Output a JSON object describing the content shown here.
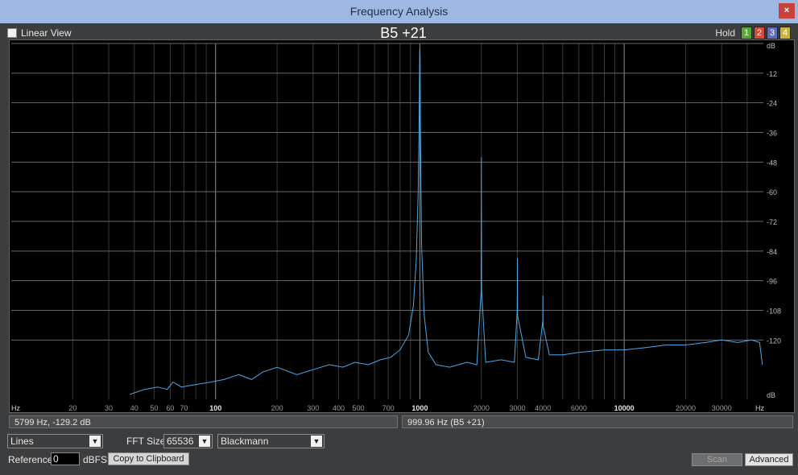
{
  "window": {
    "title": "Frequency Analysis",
    "close_glyph": "×"
  },
  "top": {
    "linear_view_label": "Linear View",
    "note": "B5 +21",
    "hold_label": "Hold",
    "hold_buttons": [
      {
        "label": "1",
        "color": "#5aa63c"
      },
      {
        "label": "2",
        "color": "#d54a3c"
      },
      {
        "label": "3",
        "color": "#5f6fb7"
      },
      {
        "label": "4",
        "color": "#c9b33d"
      }
    ]
  },
  "status": {
    "cursor": "5799 Hz, -129.2 dB",
    "peak": "999.96 Hz (B5 +21)"
  },
  "controls": {
    "display_mode": "Lines",
    "fft_size_label": "FFT Size",
    "fft_size": "65536",
    "window_function": "Blackmann",
    "reference_label": "Reference",
    "reference_value": "0",
    "reference_unit": "dBFS",
    "copy_label": "Copy to Clipboard",
    "scan_label": "Scan",
    "advanced_label": "Advanced"
  },
  "chart_data": {
    "type": "line",
    "scale": "log-frequency",
    "xlim": [
      10,
      48000
    ],
    "ylim": [
      -144,
      0
    ],
    "x_unit_label": "Hz",
    "y_unit_label": "dB",
    "x_ticks": [
      {
        "value": 20,
        "label": "20",
        "major": false
      },
      {
        "value": 30,
        "label": "30",
        "major": false
      },
      {
        "value": 40,
        "label": "40",
        "major": false
      },
      {
        "value": 50,
        "label": "50",
        "major": false
      },
      {
        "value": 60,
        "label": "60",
        "major": false
      },
      {
        "value": 70,
        "label": "70",
        "major": false
      },
      {
        "value": 100,
        "label": "100",
        "major": true
      },
      {
        "value": 200,
        "label": "200",
        "major": false
      },
      {
        "value": 300,
        "label": "300",
        "major": false
      },
      {
        "value": 400,
        "label": "400",
        "major": false
      },
      {
        "value": 500,
        "label": "500",
        "major": false
      },
      {
        "value": 700,
        "label": "700",
        "major": false
      },
      {
        "value": 1000,
        "label": "1000",
        "major": true
      },
      {
        "value": 2000,
        "label": "2000",
        "major": false
      },
      {
        "value": 3000,
        "label": "3000",
        "major": false
      },
      {
        "value": 4000,
        "label": "4000",
        "major": false
      },
      {
        "value": 6000,
        "label": "6000",
        "major": false
      },
      {
        "value": 10000,
        "label": "10000",
        "major": true
      },
      {
        "value": 20000,
        "label": "20000",
        "major": false
      },
      {
        "value": 30000,
        "label": "30000",
        "major": false
      }
    ],
    "y_ticks": [
      -12,
      -24,
      -36,
      -48,
      -60,
      -72,
      -84,
      -96,
      -108,
      -120
    ],
    "series": [
      {
        "color": "#4aa8e8",
        "points": [
          [
            38,
            -142
          ],
          [
            45,
            -140
          ],
          [
            52,
            -139
          ],
          [
            58,
            -140
          ],
          [
            62,
            -137
          ],
          [
            68,
            -139
          ],
          [
            80,
            -138
          ],
          [
            95,
            -137
          ],
          [
            110,
            -136
          ],
          [
            130,
            -134
          ],
          [
            150,
            -136
          ],
          [
            170,
            -133
          ],
          [
            200,
            -131
          ],
          [
            250,
            -134
          ],
          [
            300,
            -132
          ],
          [
            360,
            -130
          ],
          [
            420,
            -131
          ],
          [
            480,
            -129
          ],
          [
            560,
            -130
          ],
          [
            640,
            -128
          ],
          [
            720,
            -127
          ],
          [
            800,
            -124
          ],
          [
            880,
            -118
          ],
          [
            930,
            -106
          ],
          [
            960,
            -88
          ],
          [
            980,
            -62
          ],
          [
            990,
            -38
          ],
          [
            996,
            -12
          ],
          [
            998,
            -3
          ],
          [
            1000,
            -2
          ],
          [
            1002,
            -6
          ],
          [
            1006,
            -35
          ],
          [
            1020,
            -82
          ],
          [
            1050,
            -110
          ],
          [
            1100,
            -125
          ],
          [
            1200,
            -130
          ],
          [
            1400,
            -131
          ],
          [
            1700,
            -129
          ],
          [
            1900,
            -130
          ],
          [
            1995,
            -100
          ],
          [
            2000,
            -46
          ],
          [
            2005,
            -100
          ],
          [
            2100,
            -129
          ],
          [
            2500,
            -128
          ],
          [
            2900,
            -129
          ],
          [
            2995,
            -108
          ],
          [
            3000,
            -87
          ],
          [
            3005,
            -110
          ],
          [
            3300,
            -127
          ],
          [
            3800,
            -128
          ],
          [
            3995,
            -112
          ],
          [
            4000,
            -102
          ],
          [
            4005,
            -114
          ],
          [
            4300,
            -126
          ],
          [
            5000,
            -126
          ],
          [
            6000,
            -125
          ],
          [
            8000,
            -124
          ],
          [
            10000,
            -124
          ],
          [
            13000,
            -123
          ],
          [
            16000,
            -122
          ],
          [
            20000,
            -122
          ],
          [
            25000,
            -121
          ],
          [
            30000,
            -120
          ],
          [
            36000,
            -121
          ],
          [
            42000,
            -120
          ],
          [
            46000,
            -121
          ],
          [
            47500,
            -130
          ]
        ]
      }
    ]
  }
}
